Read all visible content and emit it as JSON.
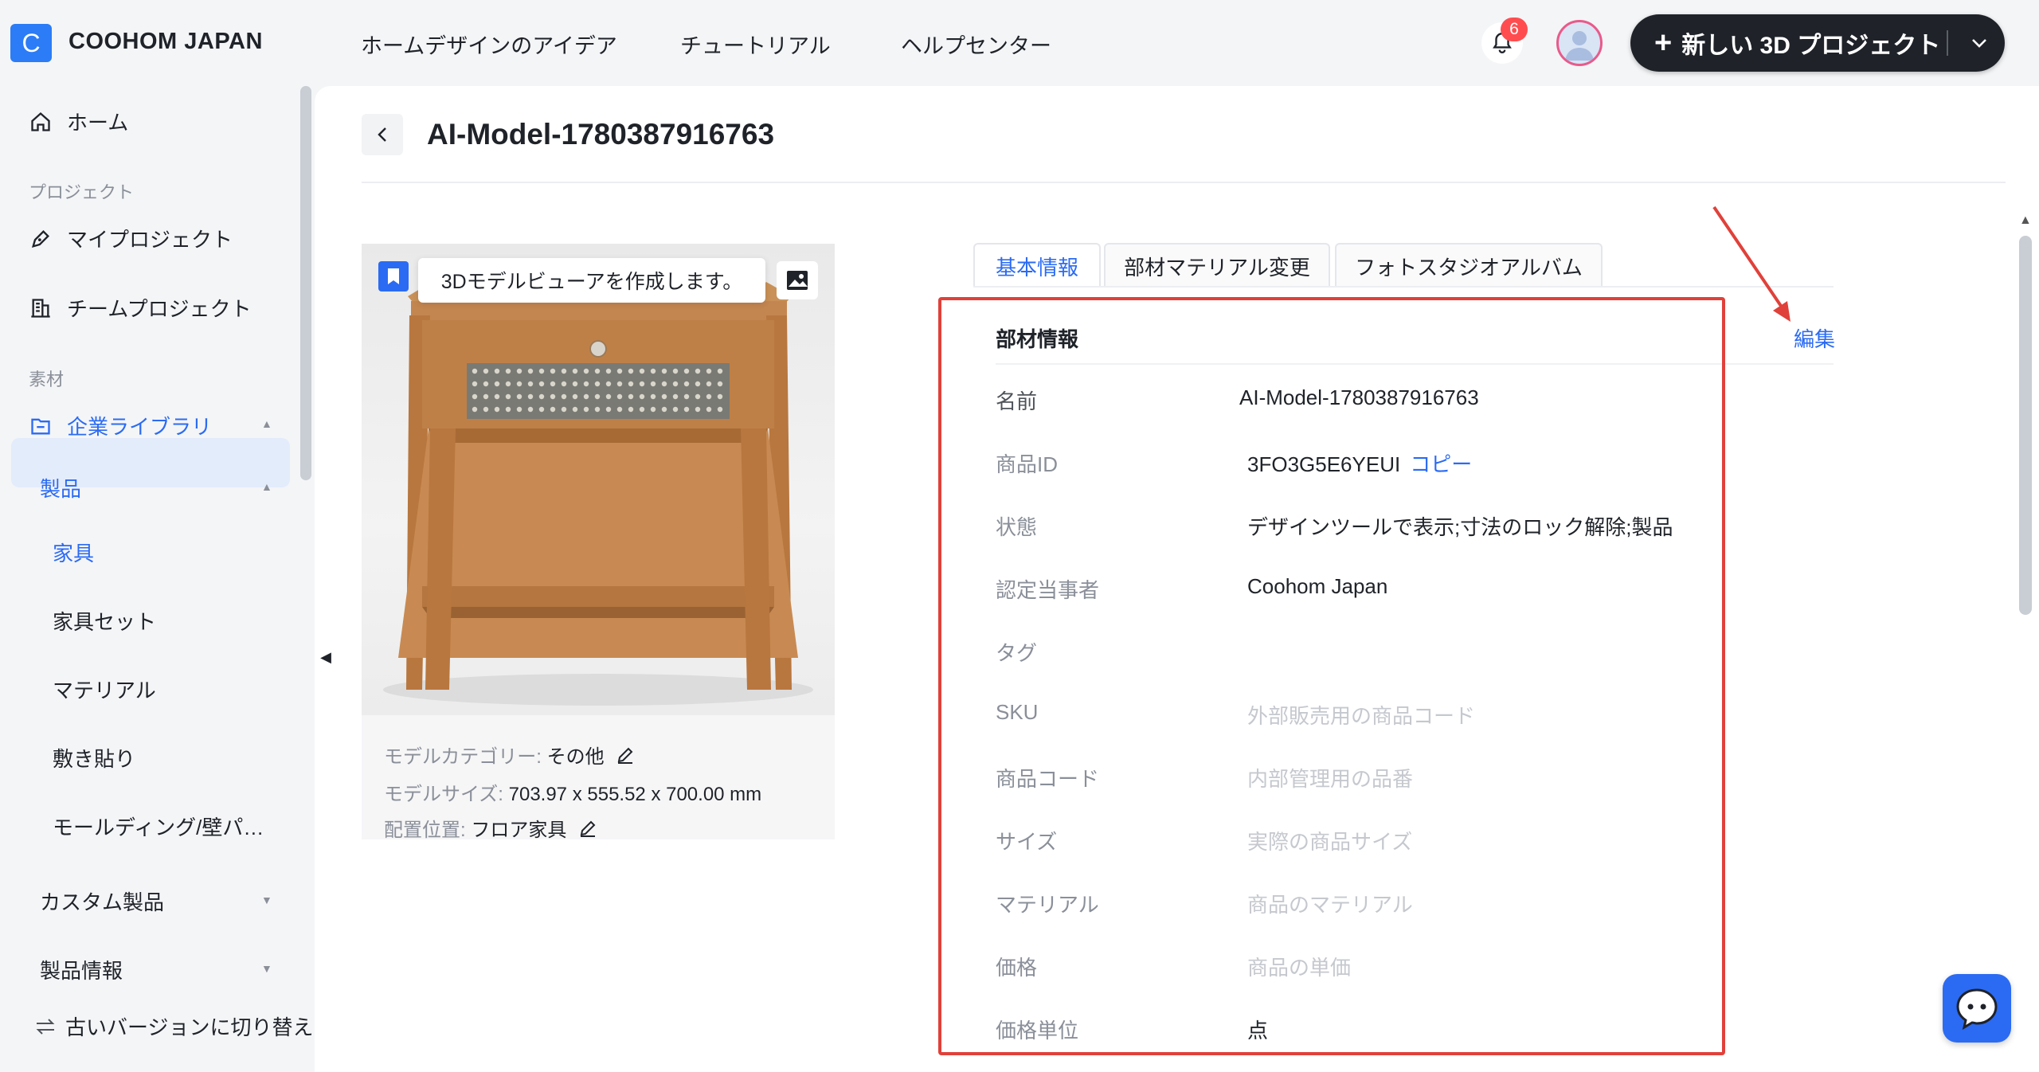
{
  "brand": {
    "logo_letter": "C",
    "name": "COOHOM JAPAN"
  },
  "topnav": {
    "items": [
      "ホームデザインのアイデア",
      "チュートリアル",
      "ヘルプセンター"
    ]
  },
  "header": {
    "notification_count": "6",
    "new_project_label": "新しい 3D プロジェクト"
  },
  "sidebar": {
    "home": "ホーム",
    "section_project": "プロジェクト",
    "my_projects": "マイプロジェクト",
    "team_projects": "チームプロジェクト",
    "section_material": "素材",
    "enterprise_library": "企業ライブラリ",
    "products": "製品",
    "furniture": "家具",
    "furniture_set": "家具セット",
    "material": "マテリアル",
    "flooring": "敷き貼り",
    "molding": "モールディング/壁パ…",
    "custom_products": "カスタム製品",
    "product_info": "製品情報",
    "switch_version": "古いバージョンに切り替え"
  },
  "page": {
    "title": "AI-Model-1780387916763"
  },
  "preview": {
    "tooltip": "3Dモデルビューアを作成します。",
    "category_label": "モデルカテゴリー:",
    "category_value": "その他",
    "size_label": "モデルサイズ:",
    "size_value": "703.97 x 555.52 x 700.00 mm",
    "placement_label": "配置位置:",
    "placement_value": "フロア家具"
  },
  "tabs": [
    "基本情報",
    "部材マテリアル変更",
    "フォトスタジオアルバム"
  ],
  "info": {
    "section_title": "部材情報",
    "edit_label": "編集",
    "copy_label": "コピー",
    "rows": [
      {
        "label": "名前",
        "value": "AI-Model-1780387916763"
      },
      {
        "label": "商品ID",
        "value": "3FO3G5E6YEUI"
      },
      {
        "label": "状態",
        "value": "デザインツールで表示;寸法のロック解除;製品"
      },
      {
        "label": "認定当事者",
        "value": "Coohom Japan"
      },
      {
        "label": "タグ",
        "value": ""
      },
      {
        "label": "SKU",
        "value": "外部販売用の商品コード"
      },
      {
        "label": "商品コード",
        "value": "内部管理用の品番"
      },
      {
        "label": "サイズ",
        "value": "実際の商品サイズ"
      },
      {
        "label": "マテリアル",
        "value": "商品のマテリアル"
      },
      {
        "label": "価格",
        "value": "商品の単価"
      },
      {
        "label": "価格単位",
        "value": "点"
      }
    ]
  },
  "colors": {
    "accent": "#2b6bf3",
    "highlight": "#e0413a",
    "dark_button": "#1f2329"
  }
}
